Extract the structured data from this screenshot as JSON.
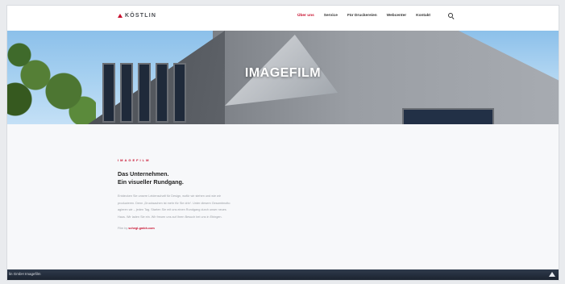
{
  "header": {
    "logo_text": "KÖSTLIN",
    "nav": [
      "Über uns",
      "Service",
      "Für Druckereien",
      "Webcenter",
      "Kontakt"
    ],
    "active_nav": "Über uns"
  },
  "hero": {
    "title": "IMAGEFILM"
  },
  "content": {
    "eyebrow": "IMAGEFILM",
    "headline_1": "Das Unternehmen.",
    "headline_2": "Ein visueller Rundgang.",
    "body_1": "Entdecken Sie unsere Leidenschaft für Design, wofür wir stehen und wie wir",
    "body_2": "produzieren. Denn „Drucksachen ist mehr für Sie drin“. Unter diesem Gesamtmotto",
    "body_3": "agieren wir – jeden Tag. Starten Sie mit uns einen Rundgang durch unser neues",
    "body_4": "Haus. Wir laden Sie ein. Wir freuen uns auf Ihren Besuch bei uns in Ebingen.",
    "credit_prefix": "Film by",
    "credit_link": "schegl-gmbh.com"
  },
  "video": {
    "title": "lin GmbH Imagefilm"
  },
  "colors": {
    "accent": "#c8102e"
  }
}
